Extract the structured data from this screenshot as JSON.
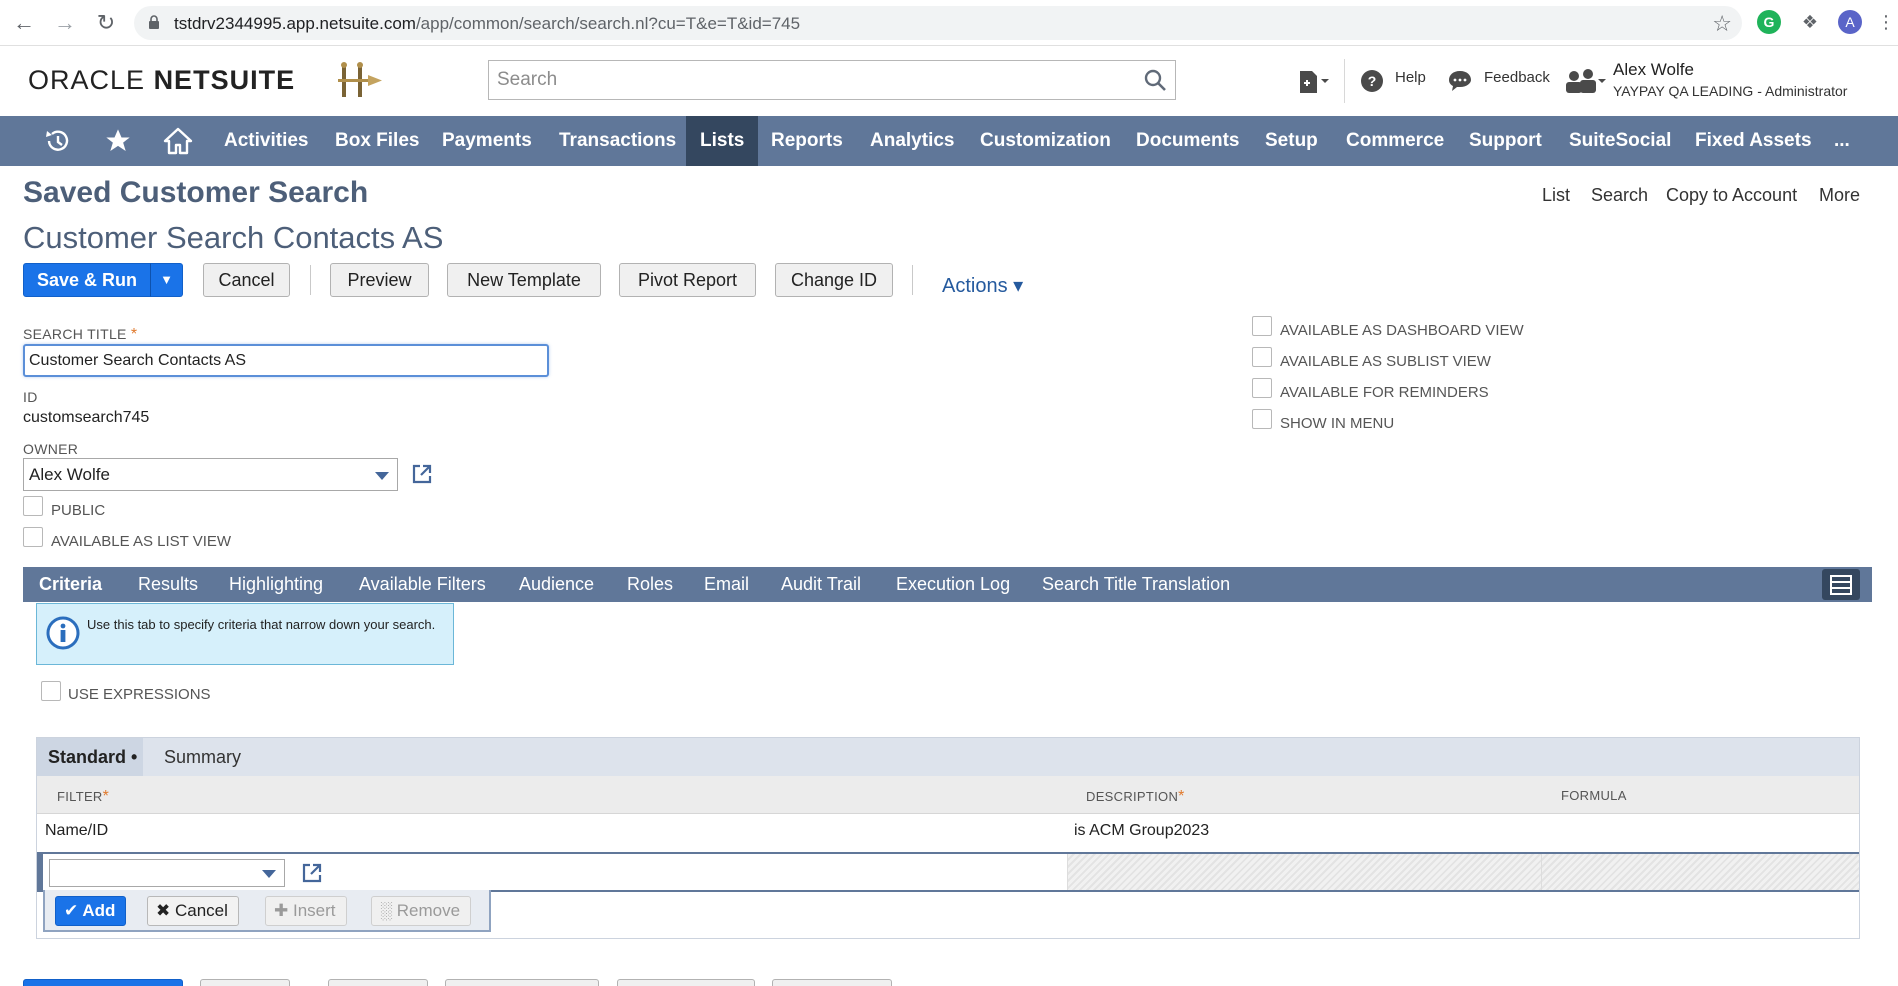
{
  "browser": {
    "url_host": "tstdrv2344995.app.netsuite.com",
    "url_path": "/app/common/search/search.nl?cu=T&e=T&id=745",
    "profile_initial": "A"
  },
  "header": {
    "logo_oracle": "ORACLE",
    "logo_netsuite": "NETSUITE",
    "search_placeholder": "Search",
    "help_label": "Help",
    "feedback_label": "Feedback",
    "user_name": "Alex Wolfe",
    "user_role": "YAYPAY QA LEADING - Administrator"
  },
  "nav": {
    "items": [
      "Activities",
      "Box Files",
      "Payments",
      "Transactions",
      "Lists",
      "Reports",
      "Analytics",
      "Customization",
      "Documents",
      "Setup",
      "Commerce",
      "Support",
      "SuiteSocial",
      "Fixed Assets",
      "..."
    ],
    "active": "Lists"
  },
  "page": {
    "title": "Saved Customer Search",
    "record_title": "Customer Search Contacts AS",
    "top_links": [
      "List",
      "Search",
      "Copy to Account",
      "More"
    ]
  },
  "buttons": {
    "save_run": "Save & Run",
    "cancel": "Cancel",
    "preview": "Preview",
    "new_template": "New Template",
    "pivot_report": "Pivot Report",
    "change_id": "Change ID",
    "actions": "Actions ▾"
  },
  "form": {
    "search_title_label": "SEARCH TITLE",
    "search_title_value": "Customer Search Contacts AS",
    "id_label": "ID",
    "id_value": "customsearch745",
    "owner_label": "OWNER",
    "owner_value": "Alex Wolfe",
    "public_label": "PUBLIC",
    "list_view_label": "AVAILABLE AS LIST VIEW",
    "dashboard_view_label": "AVAILABLE AS DASHBOARD VIEW",
    "sublist_view_label": "AVAILABLE AS SUBLIST VIEW",
    "reminders_label": "AVAILABLE FOR REMINDERS",
    "show_menu_label": "SHOW IN MENU"
  },
  "subtabs": {
    "items": [
      "Criteria",
      "Results",
      "Highlighting",
      "Available Filters",
      "Audience",
      "Roles",
      "Email",
      "Audit Trail",
      "Execution Log",
      "Search Title Translation"
    ],
    "active": "Criteria"
  },
  "criteria": {
    "info_text": "Use this tab to specify criteria that narrow down your search.",
    "use_expressions_label": "USE EXPRESSIONS",
    "tab_standard": "Standard",
    "tab_summary": "Summary",
    "columns": {
      "filter": "FILTER",
      "description": "DESCRIPTION",
      "formula": "FORMULA"
    },
    "rows": [
      {
        "filter": "Name/ID",
        "description": "is ACM Group2023",
        "formula": ""
      }
    ],
    "row_buttons": {
      "add": "Add",
      "cancel": "Cancel",
      "insert": "Insert",
      "remove": "Remove"
    }
  }
}
